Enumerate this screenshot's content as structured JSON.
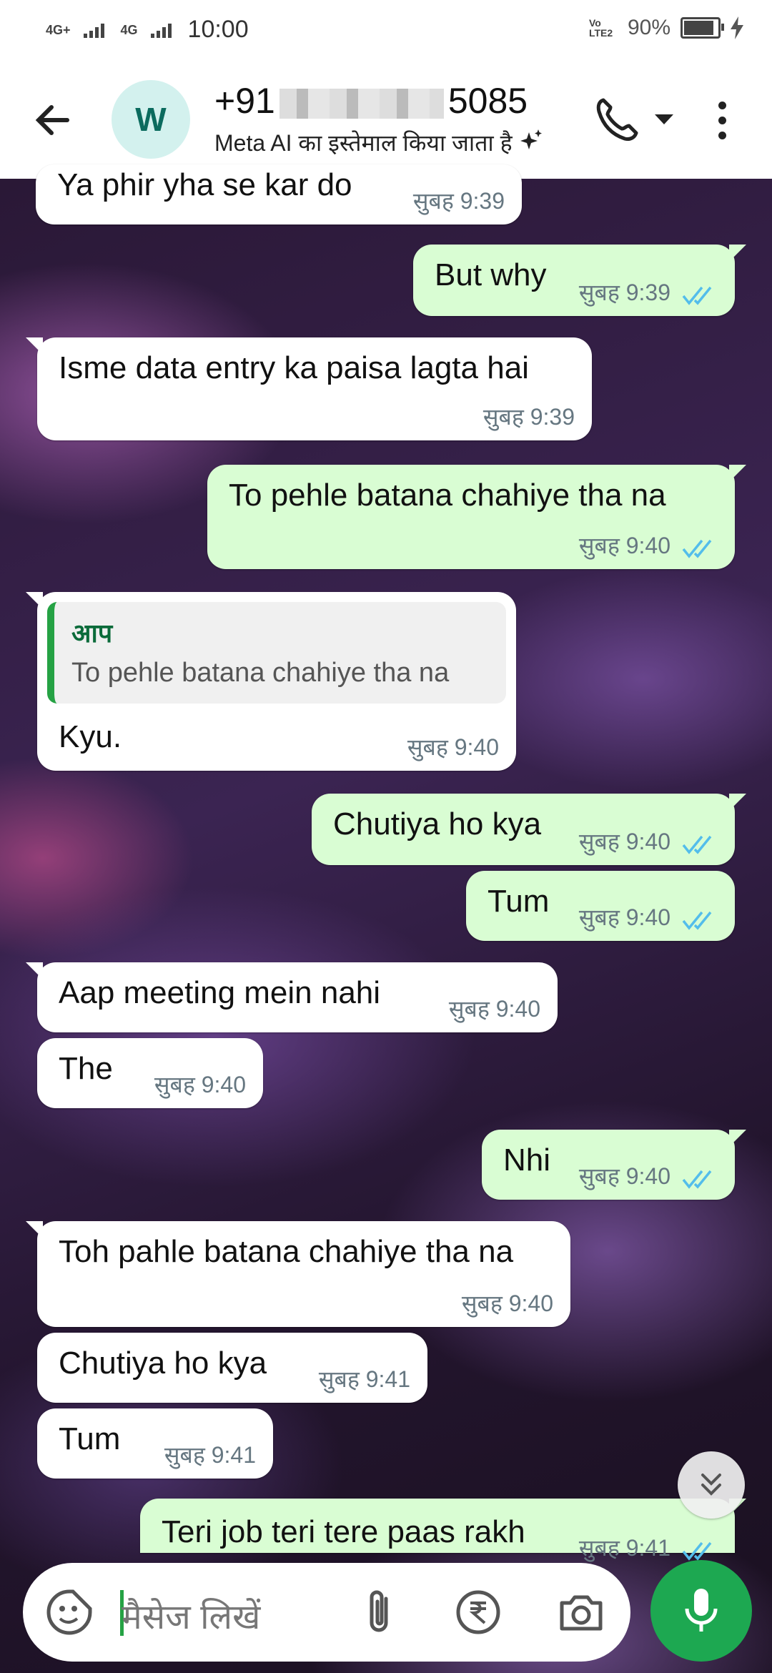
{
  "status_bar": {
    "net1": "4G+",
    "net2": "4G",
    "time": "10:00",
    "volte": "Vo LTE2",
    "battery_text": "90%",
    "battery_level": 0.9
  },
  "header": {
    "avatar_letter": "W",
    "name_prefix": "+91",
    "name_suffix": "5085",
    "subtitle": "Meta AI का इस्तेमाल किया जाता है"
  },
  "messages": [
    {
      "dir": "in",
      "text": "Ya phir yha se kar do",
      "time": "सुबह 9:39"
    },
    {
      "dir": "out",
      "text": "But why",
      "time": "सुबह 9:39"
    },
    {
      "dir": "in",
      "text": "Isme data entry ka paisa lagta hai",
      "time": "सुबह 9:39"
    },
    {
      "dir": "out",
      "text": "To pehle  batana chahiye tha na",
      "time": "सुबह 9:40"
    },
    {
      "dir": "in",
      "quote_name": "आप",
      "quote_text": "To pehle  batana chahiye tha na",
      "text": "Kyu.",
      "time": "सुबह 9:40"
    },
    {
      "dir": "out",
      "text": "Chutiya ho kya",
      "time": "सुबह 9:40"
    },
    {
      "dir": "out",
      "text": "Tum",
      "time": "सुबह 9:40"
    },
    {
      "dir": "in",
      "text": "Aap meeting mein nahi",
      "time": "सुबह 9:40"
    },
    {
      "dir": "in",
      "text": "The",
      "time": "सुबह 9:40"
    },
    {
      "dir": "out",
      "text": "Nhi",
      "time": "सुबह 9:40"
    },
    {
      "dir": "in",
      "text": "Toh pahle batana chahiye tha na",
      "time": "सुबह 9:40"
    },
    {
      "dir": "in",
      "text": "Chutiya ho kya",
      "time": "सुबह 9:41"
    },
    {
      "dir": "in",
      "text": "Tum",
      "time": "सुबह 9:41"
    },
    {
      "dir": "out",
      "text": "Teri job teri tere paas rakh",
      "time": "सुबह 9:41"
    }
  ],
  "input": {
    "placeholder": "मैसेज लिखें"
  },
  "colors": {
    "incoming_bubble": "#ffffff",
    "outgoing_bubble": "#d9fdd3",
    "tick_read": "#53bdeb",
    "mic_button": "#1da851"
  },
  "icons": [
    "back-arrow-icon",
    "call-icon",
    "dropdown-icon",
    "more-options-icon",
    "meta-ai-sparkle-icon",
    "double-tick-icon",
    "scroll-down-icon",
    "emoji-sticker-icon",
    "attach-icon",
    "rupee-payment-icon",
    "camera-icon",
    "mic-icon"
  ]
}
